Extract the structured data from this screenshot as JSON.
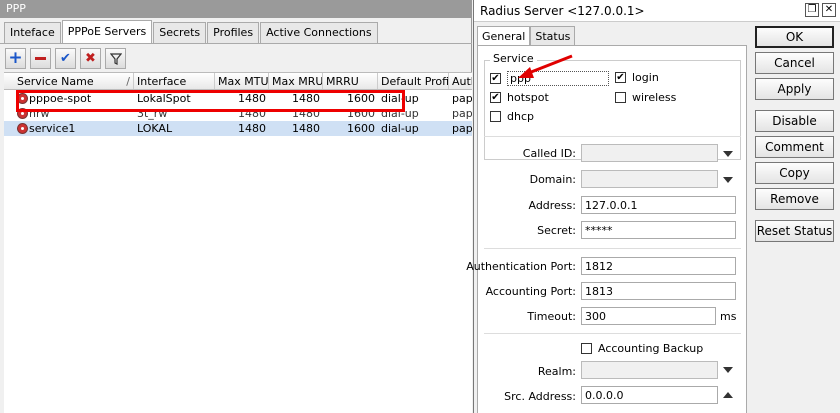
{
  "ppp": {
    "title": "PPP",
    "tabs": [
      "Inteface",
      "PPPoE Servers",
      "Secrets",
      "Profiles",
      "Active Connections"
    ],
    "active_tab": 1,
    "columns": [
      "Service Name",
      "Interface",
      "Max MTU",
      "Max MRU",
      "MRRU",
      "Default Profile",
      "Auth"
    ],
    "rows": [
      [
        "pppoe-spot",
        "LokalSpot",
        "1480",
        "1480",
        "1600",
        "dial-up",
        "pap"
      ],
      [
        "hrw",
        "3t_rw",
        "1480",
        "1480",
        "1600",
        "dial-up",
        "pap"
      ],
      [
        "service1",
        "LOKAL",
        "1480",
        "1480",
        "1600",
        "dial-up",
        "pap"
      ]
    ],
    "selected_row": 2
  },
  "radius": {
    "title": "Radius Server <127.0.0.1>",
    "tabs": [
      "General",
      "Status"
    ],
    "service_label": "Service",
    "services": {
      "ppp": {
        "label": "ppp",
        "checked": true
      },
      "login": {
        "label": "login",
        "checked": true
      },
      "hotspot": {
        "label": "hotspot",
        "checked": true
      },
      "wireless": {
        "label": "wireless",
        "checked": false
      },
      "dhcp": {
        "label": "dhcp",
        "checked": false
      }
    },
    "fields": {
      "called_id": {
        "label": "Called ID:",
        "value": ""
      },
      "domain": {
        "label": "Domain:",
        "value": ""
      },
      "address": {
        "label": "Address:",
        "value": "127.0.0.1"
      },
      "secret": {
        "label": "Secret:",
        "value": "*****"
      },
      "auth_port": {
        "label": "Authentication Port:",
        "value": "1812"
      },
      "acct_port": {
        "label": "Accounting Port:",
        "value": "1813"
      },
      "timeout": {
        "label": "Timeout:",
        "value": "300",
        "unit": "ms"
      },
      "acct_backup": {
        "label": "Accounting Backup",
        "checked": false
      },
      "realm": {
        "label": "Realm:",
        "value": ""
      },
      "src_address": {
        "label": "Src. Address:",
        "value": "0.0.0.0"
      }
    },
    "buttons": {
      "ok": "OK",
      "cancel": "Cancel",
      "apply": "Apply",
      "disable": "Disable",
      "comment": "Comment",
      "copy": "Copy",
      "remove": "Remove",
      "reset_status": "Reset Status"
    }
  },
  "colors": {
    "highlight": "#e00000",
    "selected_row": "#cfe0f4",
    "arrow": "#e00000"
  }
}
